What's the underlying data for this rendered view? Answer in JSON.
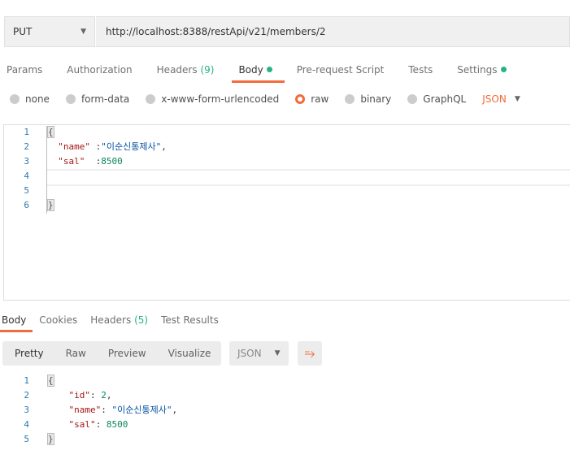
{
  "request": {
    "method": "PUT",
    "url": "http://localhost:8388/restApi/v21/members/2"
  },
  "tabs": [
    {
      "label": "Params"
    },
    {
      "label": "Authorization"
    },
    {
      "label": "Headers",
      "count": "(9)"
    },
    {
      "label": "Body",
      "dot": true,
      "active": true
    },
    {
      "label": "Pre-request Script"
    },
    {
      "label": "Tests"
    },
    {
      "label": "Settings",
      "dot": true
    }
  ],
  "body_types": [
    {
      "label": "none"
    },
    {
      "label": "form-data"
    },
    {
      "label": "x-www-form-urlencoded"
    },
    {
      "label": "raw",
      "selected": true
    },
    {
      "label": "binary"
    },
    {
      "label": "GraphQL"
    }
  ],
  "body_format": "JSON",
  "request_body": {
    "lines": [
      {
        "n": "1",
        "tokens": [
          [
            "brace",
            "{"
          ]
        ]
      },
      {
        "n": "2",
        "tokens": [
          [
            "p",
            "  "
          ],
          [
            "k",
            "\"name\""
          ],
          [
            "p",
            " :"
          ],
          [
            "s",
            "\"이순신통제사\""
          ],
          [
            "p",
            ","
          ]
        ]
      },
      {
        "n": "3",
        "tokens": [
          [
            "p",
            "  "
          ],
          [
            "k",
            "\"sal\""
          ],
          [
            "p",
            "  :"
          ],
          [
            "n",
            "8500"
          ]
        ]
      },
      {
        "n": "4",
        "tokens": []
      },
      {
        "n": "5",
        "tokens": []
      },
      {
        "n": "6",
        "tokens": [
          [
            "brace",
            "}"
          ]
        ]
      }
    ]
  },
  "response_tabs": [
    {
      "label": "Body",
      "active": true
    },
    {
      "label": "Cookies"
    },
    {
      "label": "Headers",
      "count": "(5)"
    },
    {
      "label": "Test Results"
    }
  ],
  "view_modes": [
    "Pretty",
    "Raw",
    "Preview",
    "Visualize"
  ],
  "response_format": "JSON",
  "response_body": {
    "lines": [
      {
        "n": "1",
        "tokens": [
          [
            "brace",
            "{"
          ]
        ]
      },
      {
        "n": "2",
        "tokens": [
          [
            "p",
            "    "
          ],
          [
            "k",
            "\"id\""
          ],
          [
            "p",
            ": "
          ],
          [
            "n",
            "2"
          ],
          [
            "p",
            ","
          ]
        ]
      },
      {
        "n": "3",
        "tokens": [
          [
            "p",
            "    "
          ],
          [
            "k",
            "\"name\""
          ],
          [
            "p",
            ": "
          ],
          [
            "s",
            "\"이순신통제사\""
          ],
          [
            "p",
            ","
          ]
        ]
      },
      {
        "n": "4",
        "tokens": [
          [
            "p",
            "    "
          ],
          [
            "k",
            "\"sal\""
          ],
          [
            "p",
            ": "
          ],
          [
            "n",
            "8500"
          ]
        ]
      },
      {
        "n": "5",
        "tokens": [
          [
            "brace",
            "}"
          ]
        ]
      }
    ]
  },
  "colors": {
    "accent": "#f26b3a",
    "green": "#26b47f"
  }
}
